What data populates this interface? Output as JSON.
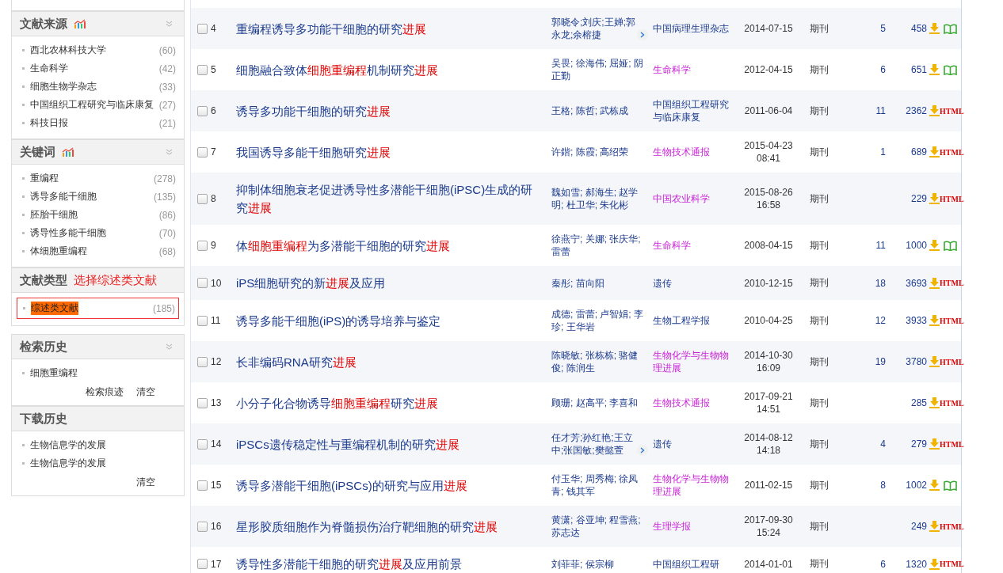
{
  "sidebar": {
    "panels": [
      {
        "title": "文献来源",
        "trend_icon": true,
        "collapsible": true,
        "items": [
          {
            "label": "西北农林科技大学",
            "count": "(60)",
            "selected": false
          },
          {
            "label": "生命科学",
            "count": "(42)",
            "selected": false
          },
          {
            "label": "细胞生物学杂志",
            "count": "(33)",
            "selected": false
          },
          {
            "label": "中国组织工程研究与临床康复",
            "count": "(27)",
            "selected": false
          },
          {
            "label": "科技日报",
            "count": "(21)",
            "selected": false
          }
        ]
      },
      {
        "title": "关键词",
        "trend_icon": true,
        "collapsible": true,
        "items": [
          {
            "label": "重编程",
            "count": "(278)",
            "selected": false
          },
          {
            "label": "诱导多能干细胞",
            "count": "(135)",
            "selected": false
          },
          {
            "label": "胚胎干细胞",
            "count": "(86)",
            "selected": false
          },
          {
            "label": "诱导性多能干细胞",
            "count": "(70)",
            "selected": false
          },
          {
            "label": "体细胞重编程",
            "count": "(68)",
            "selected": false
          }
        ]
      },
      {
        "title": "文献类型",
        "trend_icon": false,
        "collapsible": false,
        "annotation": "选择综述类文献",
        "items": [
          {
            "label": "综述类文献",
            "count": "(185)",
            "selected": true
          }
        ]
      }
    ],
    "history_panels": [
      {
        "title": "检索历史",
        "collapsible": true,
        "items": [
          "细胞重编程"
        ],
        "links": [
          "检索痕迹",
          "清空"
        ]
      },
      {
        "title": "下载历史",
        "collapsible": false,
        "items": [
          "生物信息学的发展",
          "生物信息学的发展"
        ],
        "links": [
          "清空"
        ]
      }
    ]
  },
  "results": [
    {
      "number": "4",
      "checked": false,
      "title": [
        {
          "text": "重编程诱导多功能干细胞的研究",
          "highlight": false
        },
        {
          "text": "进展",
          "highlight": true
        }
      ],
      "authors": "郭晓令;刘庆;王婵;郭永龙;余榕捷",
      "more_authors": true,
      "source": {
        "text": "中国病理生理杂志",
        "visited": false
      },
      "date": [
        "2014-07-15"
      ],
      "type": "期刊",
      "cited": "5",
      "downloads": "458",
      "read": {
        "kind": "book"
      }
    },
    {
      "number": "5",
      "checked": false,
      "title": [
        {
          "text": "细胞融合致体",
          "highlight": false
        },
        {
          "text": "细胞重编程",
          "highlight": true
        },
        {
          "text": "机制研究",
          "highlight": false
        },
        {
          "text": "进展",
          "highlight": true
        }
      ],
      "authors": "吴畏; 徐海伟; 屈娅; 阴正勤",
      "more_authors": false,
      "source": {
        "text": "生命科学",
        "visited": true
      },
      "date": [
        "2012-04-15"
      ],
      "type": "期刊",
      "cited": "6",
      "downloads": "651",
      "read": {
        "kind": "book"
      }
    },
    {
      "number": "6",
      "checked": false,
      "title": [
        {
          "text": "诱导多功能干细胞的研究",
          "highlight": false
        },
        {
          "text": "进展",
          "highlight": true
        }
      ],
      "authors": "王格; 陈哲; 武栋成",
      "more_authors": false,
      "source": {
        "text": "中国组织工程研究与临床康复",
        "visited": false
      },
      "date": [
        "2011-06-04"
      ],
      "type": "期刊",
      "cited": "11",
      "downloads": "2362",
      "read": {
        "kind": "html",
        "text": "HTML"
      }
    },
    {
      "number": "7",
      "checked": false,
      "title": [
        {
          "text": "我国诱导多能干细胞研究",
          "highlight": false
        },
        {
          "text": "进展",
          "highlight": true
        }
      ],
      "authors": "许鍇; 陈霞; 高绍荣",
      "more_authors": false,
      "source": {
        "text": "生物技术通报",
        "visited": true
      },
      "date": [
        "2015-04-23",
        "08:41"
      ],
      "type": "期刊",
      "cited": "1",
      "downloads": "689",
      "read": {
        "kind": "html",
        "text": "HTML"
      }
    },
    {
      "number": "8",
      "checked": false,
      "title": [
        {
          "text": "抑制体细胞衰老促进诱导性多潜能干细胞(iPSC)生成的研究",
          "highlight": false
        },
        {
          "text": "进展",
          "highlight": true
        }
      ],
      "authors": "魏如雪; 郝海生; 赵学明; 杜卫华; 朱化彬",
      "more_authors": false,
      "source": {
        "text": "中国农业科学",
        "visited": true
      },
      "date": [
        "2015-08-26",
        "16:58"
      ],
      "type": "期刊",
      "downloads": "229",
      "read": {
        "kind": "html",
        "text": "HTML"
      }
    },
    {
      "number": "9",
      "checked": false,
      "title": [
        {
          "text": "体",
          "highlight": false
        },
        {
          "text": "细胞重编程",
          "highlight": true
        },
        {
          "text": "为多潜能干细胞的研究",
          "highlight": false
        },
        {
          "text": "进展",
          "highlight": true
        }
      ],
      "authors": "徐燕宁; 关娜; 张庆华; 雷蕾",
      "more_authors": false,
      "source": {
        "text": "生命科学",
        "visited": true
      },
      "date": [
        "2008-04-15"
      ],
      "type": "期刊",
      "cited": "11",
      "downloads": "1000",
      "read": {
        "kind": "book"
      }
    },
    {
      "number": "10",
      "checked": false,
      "title": [
        {
          "text": "iPS细胞研究的新",
          "highlight": false
        },
        {
          "text": "进展",
          "highlight": true
        },
        {
          "text": "及应用",
          "highlight": false
        }
      ],
      "authors": "秦彤; 苗向阳",
      "more_authors": false,
      "source": {
        "text": "遗传",
        "visited": false
      },
      "date": [
        "2010-12-15"
      ],
      "type": "期刊",
      "cited": "18",
      "downloads": "3693",
      "read": {
        "kind": "html",
        "text": "HTML"
      }
    },
    {
      "number": "11",
      "checked": false,
      "title": [
        {
          "text": "诱导多能干细胞(iPS)的诱导培养与鉴定",
          "highlight": false
        }
      ],
      "authors": "成德; 雷蕾; 卢智娟; 李珍; 王华岩",
      "more_authors": false,
      "source": {
        "text": "生物工程学报",
        "visited": false
      },
      "date": [
        "2010-04-25"
      ],
      "type": "期刊",
      "cited": "12",
      "downloads": "3933",
      "read": {
        "kind": "html",
        "text": "HTML"
      }
    },
    {
      "number": "12",
      "checked": false,
      "title": [
        {
          "text": "长非编码RNA研究",
          "highlight": false
        },
        {
          "text": "进展",
          "highlight": true
        }
      ],
      "authors": "陈晓敏; 张栋栋; 骆健俊; 陈润生",
      "more_authors": false,
      "source": {
        "text": "生物化学与生物物理进展",
        "visited": true
      },
      "date": [
        "2014-10-30",
        "16:09"
      ],
      "type": "期刊",
      "cited": "19",
      "downloads": "3780",
      "read": {
        "kind": "html",
        "text": "HTML"
      }
    },
    {
      "number": "13",
      "checked": false,
      "title": [
        {
          "text": "小分子化合物诱导",
          "highlight": false
        },
        {
          "text": "细胞重编程",
          "highlight": true
        },
        {
          "text": "研究",
          "highlight": false
        },
        {
          "text": "进展",
          "highlight": true
        }
      ],
      "authors": "顾珊; 赵高平; 李喜和",
      "more_authors": false,
      "source": {
        "text": "生物技术通报",
        "visited": true
      },
      "date": [
        "2017-09-21",
        "14:51"
      ],
      "type": "期刊",
      "downloads": "285",
      "read": {
        "kind": "html",
        "text": "HTML"
      }
    },
    {
      "number": "14",
      "checked": false,
      "title": [
        {
          "text": "iPSCs遗传稳定性与重编程机制的研究",
          "highlight": false
        },
        {
          "text": "进展",
          "highlight": true
        }
      ],
      "authors": "任才芳;孙红艳;王立中;张国敏;樊懿萱",
      "more_authors": true,
      "source": {
        "text": "遗传",
        "visited": false
      },
      "date": [
        "2014-08-12",
        "14:18"
      ],
      "type": "期刊",
      "cited": "4",
      "downloads": "279",
      "read": {
        "kind": "html",
        "text": "HTML"
      }
    },
    {
      "number": "15",
      "checked": false,
      "title": [
        {
          "text": "诱导多潜能干细胞(iPSCs)的研究与应用",
          "highlight": false
        },
        {
          "text": "进展",
          "highlight": true
        }
      ],
      "authors": "付玉华; 周秀梅; 徐凤青; 钱其军",
      "more_authors": false,
      "source": {
        "text": "生物化学与生物物理进展",
        "visited": true
      },
      "date": [
        "2011-02-15"
      ],
      "type": "期刊",
      "cited": "8",
      "downloads": "1002",
      "read": {
        "kind": "book"
      }
    },
    {
      "number": "16",
      "checked": false,
      "title": [
        {
          "text": "星形胶质细胞作为脊髓损伤治疗靶细胞的研究",
          "highlight": false
        },
        {
          "text": "进展",
          "highlight": true
        }
      ],
      "authors": "黄潇; 谷亚坤; 程雪燕; 苏志达",
      "more_authors": false,
      "source": {
        "text": "生理学报",
        "visited": true
      },
      "date": [
        "2017-09-30",
        "15:24"
      ],
      "type": "期刊",
      "downloads": "249",
      "read": {
        "kind": "html",
        "text": "HTML"
      }
    },
    {
      "number": "17",
      "checked": false,
      "title": [
        {
          "text": "诱导性多潜能干细胞的研究",
          "highlight": false
        },
        {
          "text": "进展",
          "highlight": true
        },
        {
          "text": "及应用前景",
          "highlight": false
        }
      ],
      "authors": "刘菲菲; 侯宗柳",
      "more_authors": false,
      "source": {
        "text": "中国组织工程研",
        "visited": false
      },
      "date": [
        "2014-01-01"
      ],
      "type": "期刊",
      "cited": "6",
      "downloads": "1320",
      "read": {
        "kind": "html",
        "text": "HTML"
      }
    }
  ]
}
